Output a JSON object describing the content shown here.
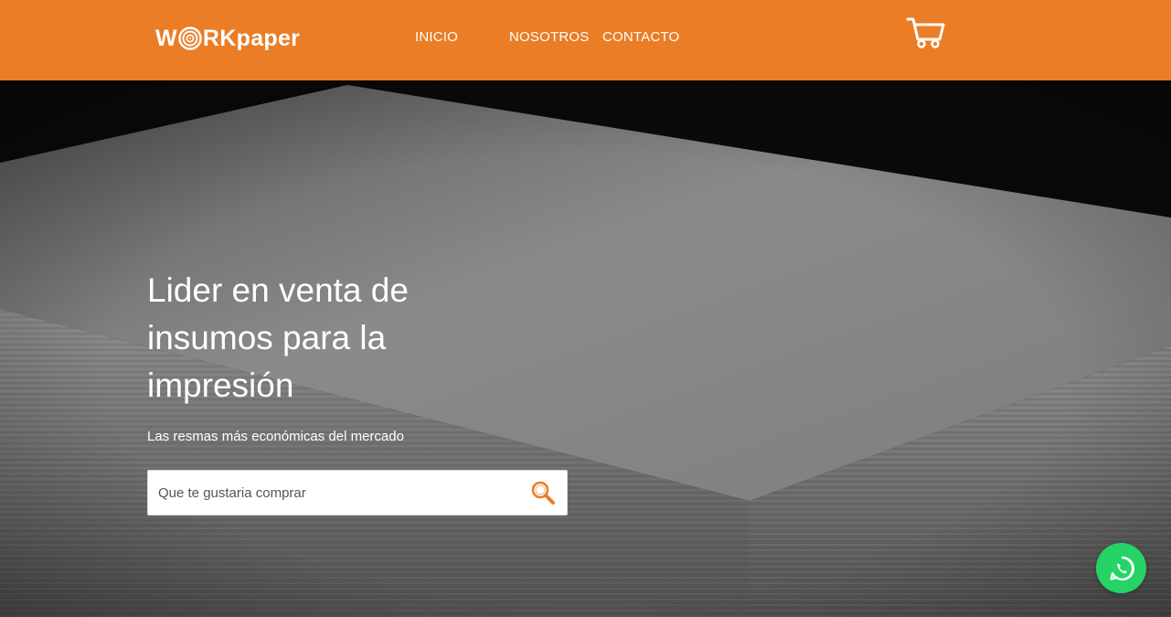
{
  "header": {
    "logo": {
      "part1": "W",
      "part2": "RK",
      "part3": "paper"
    },
    "nav": [
      {
        "label": "INICIO"
      },
      {
        "label": "NOSOTROS"
      },
      {
        "label": "CONTACTO"
      }
    ],
    "cart_icon": "shopping-cart-icon"
  },
  "hero": {
    "headline": "Lider en venta de insumos para la impresión",
    "subline": "Las resmas más económicas del mercado",
    "search": {
      "placeholder": "Que te gustaria comprar",
      "value": "",
      "icon": "magnifier-icon"
    }
  },
  "floating": {
    "icon": "whatsapp-icon"
  },
  "colors": {
    "brand": "#ea7d25",
    "whatsapp": "#25d366",
    "white": "#ffffff"
  }
}
